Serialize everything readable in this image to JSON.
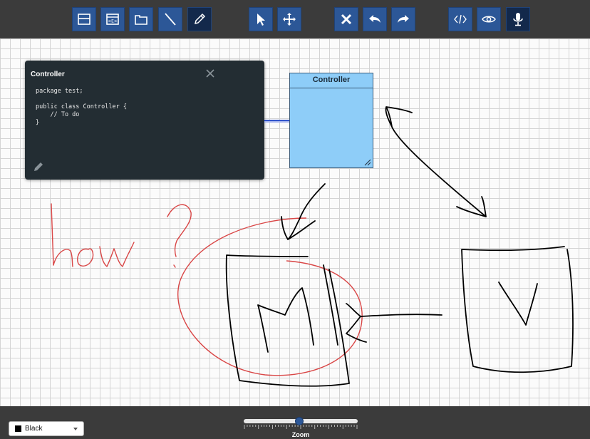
{
  "toolbar": {
    "groups": [
      {
        "name": "create-tools",
        "items": [
          "class-icon",
          "interface-icon",
          "package-icon",
          "line-icon",
          "pencil-icon"
        ]
      },
      {
        "name": "navigation-tools",
        "items": [
          "pointer-icon",
          "move-icon"
        ]
      },
      {
        "name": "edit-tools",
        "items": [
          "delete-icon",
          "undo-icon",
          "redo-icon"
        ]
      },
      {
        "name": "view-tools",
        "items": [
          "code-icon",
          "eye-icon",
          "microphone-icon"
        ]
      }
    ],
    "active_items": [
      "pencil-icon",
      "microphone-icon"
    ],
    "colors": {
      "button": "#2c5797",
      "active_button": "#13294b",
      "bar": "#3b3b3b"
    }
  },
  "code_panel": {
    "title": "Controller",
    "code": "package test;\n\npublic class Controller {\n    // To do\n}",
    "close_icon": "close-icon",
    "edit_icon": "pencil-icon"
  },
  "uml_class": {
    "name": "Controller",
    "fill_color": "#8ecdf8"
  },
  "drawing": {
    "pen_colors": [
      "#000000",
      "#e04040"
    ],
    "connector_color": "#3355cc"
  },
  "bottom_bar": {
    "color_select": {
      "value": "Black",
      "swatch": "#000000"
    },
    "zoom": {
      "label": "Zoom",
      "value_fraction": 0.49
    }
  }
}
